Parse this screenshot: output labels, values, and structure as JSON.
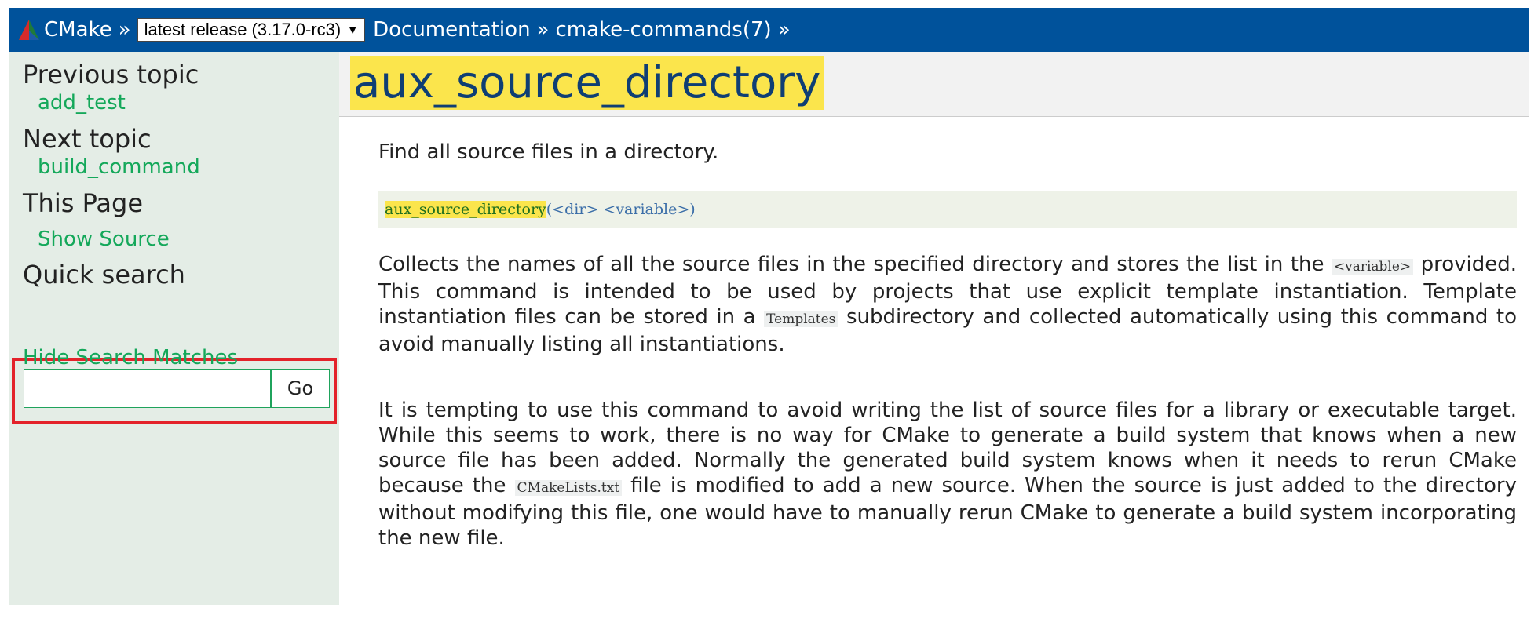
{
  "topbar": {
    "home": "CMake",
    "sep": "»",
    "version_select": "latest release (3.17.0-rc3)",
    "documentation": "Documentation",
    "commands": "cmake-commands(7)"
  },
  "sidebar": {
    "previous_heading": "Previous topic",
    "previous_link": "add_test",
    "next_heading": "Next topic",
    "next_link": "build_command",
    "this_page_heading": "This Page",
    "show_source": "Show Source",
    "quick_search_heading": "Quick search",
    "search_value": "",
    "go_label": "Go",
    "hide_matches": "Hide Search Matches"
  },
  "main": {
    "title": "aux_source_directory",
    "description": "Find all source files in a directory.",
    "signature_name": "aux_source_directory",
    "signature_args": "(<dir> <variable>)",
    "para1": {
      "t1": "Collects the names of all the source files in the specified directory and stores the list in the ",
      "c1": "<variable>",
      "t2": " provided. This command is intended to be used by projects that use explicit template instantiation. Template instantiation files can be stored in a ",
      "c2": "Templates",
      "t3": " subdirectory and collected automatically using this command to avoid manually listing all instantiations."
    },
    "para2": {
      "t1": "It is tempting to use this command to avoid writing the list of source files for a library or executable target. While this seems to work, there is no way for CMake to generate a build system that knows when a new source file has been added. Normally the generated build system knows when it needs to rerun CMake because the ",
      "c1": "CMakeLists.txt",
      "t2": " file is modified to add a new source. When the source is just added to the directory without modifying this file, one would have to manually rerun CMake to generate a build system incorporating the new file."
    }
  },
  "colors": {
    "topbar": "#00529b",
    "sidebar": "#e4ede6",
    "link": "#14a85a",
    "highlight": "#fbe54c",
    "search_outline": "#e3222a"
  },
  "icons": {
    "logo": "cmake-triangle-logo-icon",
    "dropdown": "dropdown-arrow-icon"
  }
}
